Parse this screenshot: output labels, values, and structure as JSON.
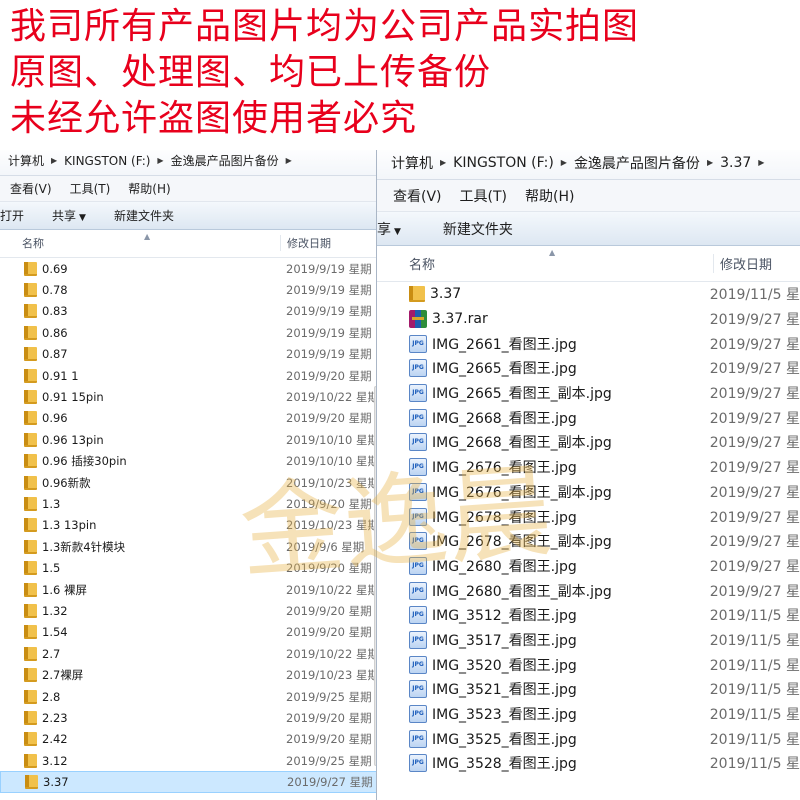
{
  "notice": {
    "lines": [
      "我司所有产品图片均为公司产品实拍图",
      "原图、处理图、均已上传备份",
      "未经允许盗图使用者必究"
    ],
    "color": "#e8001c"
  },
  "watermark": {
    "text": "金逸晨",
    "color": "#e8b246"
  },
  "left_window": {
    "breadcrumb": [
      "计算机",
      "KINGSTON (F:)",
      "金逸晨产品图片备份"
    ],
    "menu": [
      "查看(V)",
      "工具(T)",
      "帮助(H)"
    ],
    "toolbar": {
      "open": "打开",
      "share": "共享",
      "new_folder": "新建文件夹"
    },
    "columns": {
      "name": "名称",
      "date": "修改日期"
    },
    "rows": [
      {
        "name": "0.69",
        "date": "2019/9/19 星期",
        "type": "folder"
      },
      {
        "name": "0.78",
        "date": "2019/9/19 星期",
        "type": "folder"
      },
      {
        "name": "0.83",
        "date": "2019/9/19 星期",
        "type": "folder"
      },
      {
        "name": "0.86",
        "date": "2019/9/19 星期",
        "type": "folder"
      },
      {
        "name": "0.87",
        "date": "2019/9/19 星期",
        "type": "folder"
      },
      {
        "name": "0.91 1",
        "date": "2019/9/20 星期",
        "type": "folder"
      },
      {
        "name": "0.91 15pin",
        "date": "2019/10/22 星期",
        "type": "folder"
      },
      {
        "name": "0.96",
        "date": "2019/9/20 星期",
        "type": "folder"
      },
      {
        "name": "0.96 13pin",
        "date": "2019/10/10 星期",
        "type": "folder"
      },
      {
        "name": "0.96 插接30pin",
        "date": "2019/10/10 星期",
        "type": "folder"
      },
      {
        "name": "0.96新款",
        "date": "2019/10/23 星期",
        "type": "folder"
      },
      {
        "name": "1.3",
        "date": "2019/9/20 星期",
        "type": "folder"
      },
      {
        "name": "1.3  13pin",
        "date": "2019/10/23 星期",
        "type": "folder"
      },
      {
        "name": "1.3新款4针模块",
        "date": "2019/9/6 星期",
        "type": "folder"
      },
      {
        "name": "1.5",
        "date": "2019/9/20 星期",
        "type": "folder"
      },
      {
        "name": "1.6 裸屏",
        "date": "2019/10/22 星期",
        "type": "folder"
      },
      {
        "name": "1.32",
        "date": "2019/9/20 星期",
        "type": "folder"
      },
      {
        "name": "1.54",
        "date": "2019/9/20 星期",
        "type": "folder"
      },
      {
        "name": "2.7",
        "date": "2019/10/22 星期",
        "type": "folder"
      },
      {
        "name": "2.7裸屏",
        "date": "2019/10/23 星期",
        "type": "folder"
      },
      {
        "name": "2.8",
        "date": "2019/9/25 星期",
        "type": "folder"
      },
      {
        "name": "2.23",
        "date": "2019/9/20 星期",
        "type": "folder"
      },
      {
        "name": "2.42",
        "date": "2019/9/20 星期",
        "type": "folder"
      },
      {
        "name": "3.12",
        "date": "2019/9/25 星期",
        "type": "folder"
      },
      {
        "name": "3.37",
        "date": "2019/9/27 星期",
        "type": "folder",
        "selected": true
      }
    ]
  },
  "right_window": {
    "breadcrumb": [
      "计算机",
      "KINGSTON (F:)",
      "金逸晨产品图片备份",
      "3.37"
    ],
    "menu": [
      "查看(V)",
      "工具(T)",
      "帮助(H)"
    ],
    "toolbar": {
      "share_partial": "享",
      "new_folder": "新建文件夹"
    },
    "columns": {
      "name": "名称",
      "date": "修改日期"
    },
    "rows": [
      {
        "name": "3.37",
        "date": "2019/11/5 星",
        "type": "folder"
      },
      {
        "name": "3.37.rar",
        "date": "2019/9/27 星",
        "type": "rar"
      },
      {
        "name": "IMG_2661_看图王.jpg",
        "date": "2019/9/27 星",
        "type": "jpg"
      },
      {
        "name": "IMG_2665_看图王.jpg",
        "date": "2019/9/27 星",
        "type": "jpg"
      },
      {
        "name": "IMG_2665_看图王_副本.jpg",
        "date": "2019/9/27 星",
        "type": "jpg"
      },
      {
        "name": "IMG_2668_看图王.jpg",
        "date": "2019/9/27 星",
        "type": "jpg"
      },
      {
        "name": "IMG_2668_看图王_副本.jpg",
        "date": "2019/9/27 星",
        "type": "jpg"
      },
      {
        "name": "IMG_2676_看图王.jpg",
        "date": "2019/9/27 星",
        "type": "jpg"
      },
      {
        "name": "IMG_2676_看图王_副本.jpg",
        "date": "2019/9/27 星",
        "type": "jpg"
      },
      {
        "name": "IMG_2678_看图王.jpg",
        "date": "2019/9/27 星",
        "type": "jpg"
      },
      {
        "name": "IMG_2678_看图王_副本.jpg",
        "date": "2019/9/27 星",
        "type": "jpg"
      },
      {
        "name": "IMG_2680_看图王.jpg",
        "date": "2019/9/27 星",
        "type": "jpg"
      },
      {
        "name": "IMG_2680_看图王_副本.jpg",
        "date": "2019/9/27 星",
        "type": "jpg"
      },
      {
        "name": "IMG_3512_看图王.jpg",
        "date": "2019/11/5 星",
        "type": "jpg"
      },
      {
        "name": "IMG_3517_看图王.jpg",
        "date": "2019/11/5 星",
        "type": "jpg"
      },
      {
        "name": "IMG_3520_看图王.jpg",
        "date": "2019/11/5 星",
        "type": "jpg"
      },
      {
        "name": "IMG_3521_看图王.jpg",
        "date": "2019/11/5 星",
        "type": "jpg"
      },
      {
        "name": "IMG_3523_看图王.jpg",
        "date": "2019/11/5 星",
        "type": "jpg"
      },
      {
        "name": "IMG_3525_看图王.jpg",
        "date": "2019/11/5 星",
        "type": "jpg"
      },
      {
        "name": "IMG_3528_看图王.jpg",
        "date": "2019/11/5 星",
        "type": "jpg"
      }
    ]
  }
}
